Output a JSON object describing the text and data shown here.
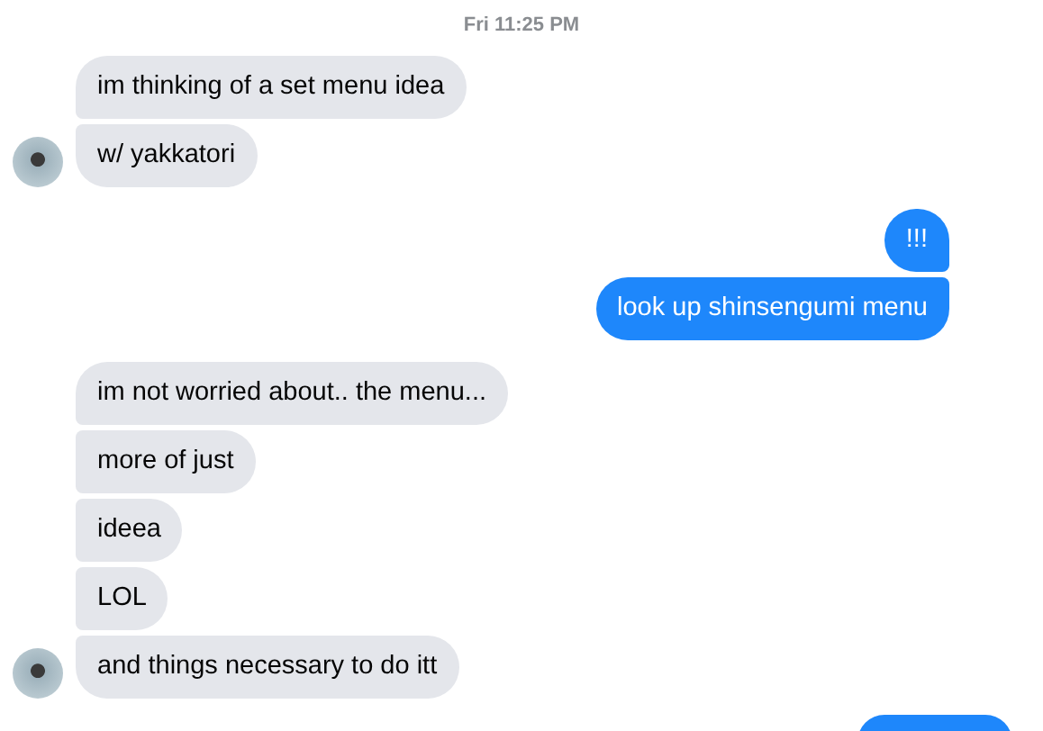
{
  "timestamp": "Fri 11:25 PM",
  "groups": [
    {
      "outgoing": false,
      "messages": [
        "im thinking of a set menu idea",
        "w/ yakkatori"
      ]
    },
    {
      "outgoing": true,
      "messages": [
        "!!!",
        "look up shinsengumi menu"
      ]
    },
    {
      "outgoing": false,
      "messages": [
        "im not worried about.. the menu...",
        "more of just",
        "ideea",
        "LOL",
        "and things necessary to do itt"
      ]
    }
  ],
  "trailing_bubble": {
    "outgoing": true
  }
}
